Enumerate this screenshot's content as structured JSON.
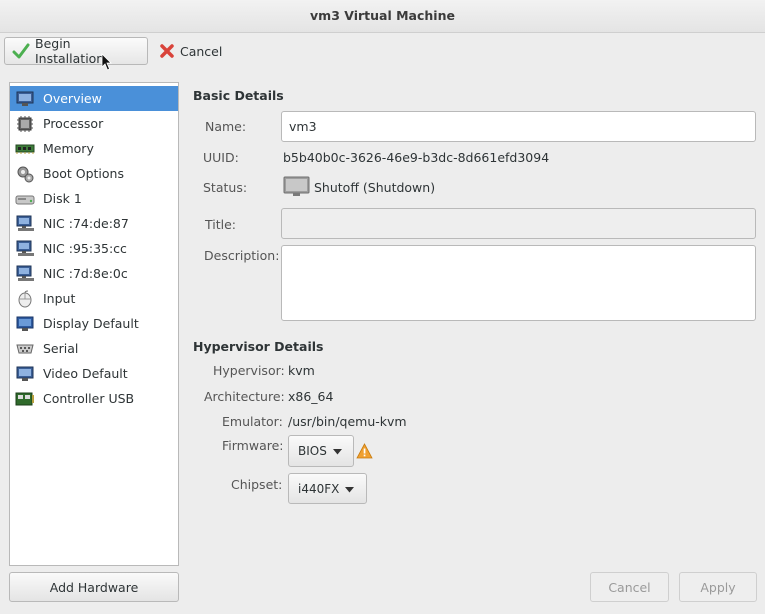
{
  "window": {
    "title": "vm3 Virtual Machine"
  },
  "toolbar": {
    "begin_label": "Begin Installation",
    "cancel_label": "Cancel"
  },
  "sidebar": {
    "items": [
      {
        "label": "Overview",
        "icon": "monitor-icon"
      },
      {
        "label": "Processor",
        "icon": "cpu-icon"
      },
      {
        "label": "Memory",
        "icon": "memory-icon"
      },
      {
        "label": "Boot Options",
        "icon": "gears-icon"
      },
      {
        "label": "Disk 1",
        "icon": "disk-icon"
      },
      {
        "label": "NIC :74:de:87",
        "icon": "network-icon"
      },
      {
        "label": "NIC :95:35:cc",
        "icon": "network-icon"
      },
      {
        "label": "NIC :7d:8e:0c",
        "icon": "network-icon"
      },
      {
        "label": "Input",
        "icon": "mouse-icon"
      },
      {
        "label": "Display Default",
        "icon": "display-icon"
      },
      {
        "label": "Serial",
        "icon": "serial-icon"
      },
      {
        "label": "Video Default",
        "icon": "video-icon"
      },
      {
        "label": "Controller USB",
        "icon": "controller-icon"
      }
    ],
    "selected": "Overview"
  },
  "basic": {
    "heading": "Basic Details",
    "name_label": "Name:",
    "name_value": "vm3",
    "uuid_label": "UUID:",
    "uuid_value": "b5b40b0c-3626-46e9-b3dc-8d661efd3094",
    "status_label": "Status:",
    "status_value": "Shutoff (Shutdown)",
    "title_label": "Title:",
    "title_value": "",
    "description_label": "Description:",
    "description_value": ""
  },
  "hypervisor": {
    "heading": "Hypervisor Details",
    "hypervisor_label": "Hypervisor:",
    "hypervisor_value": "kvm",
    "arch_label": "Architecture:",
    "arch_value": "x86_64",
    "emulator_label": "Emulator:",
    "emulator_value": "/usr/bin/qemu-kvm",
    "firmware_label": "Firmware:",
    "firmware_value": "BIOS",
    "chipset_label": "Chipset:",
    "chipset_value": "i440FX"
  },
  "buttons": {
    "add_hardware": "Add Hardware",
    "cancel": "Cancel",
    "apply": "Apply"
  },
  "colors": {
    "selection": "#4a90d9",
    "warning": "#f0a030",
    "begin_check": "#4caf50",
    "cancel_x": "#d9433a"
  }
}
